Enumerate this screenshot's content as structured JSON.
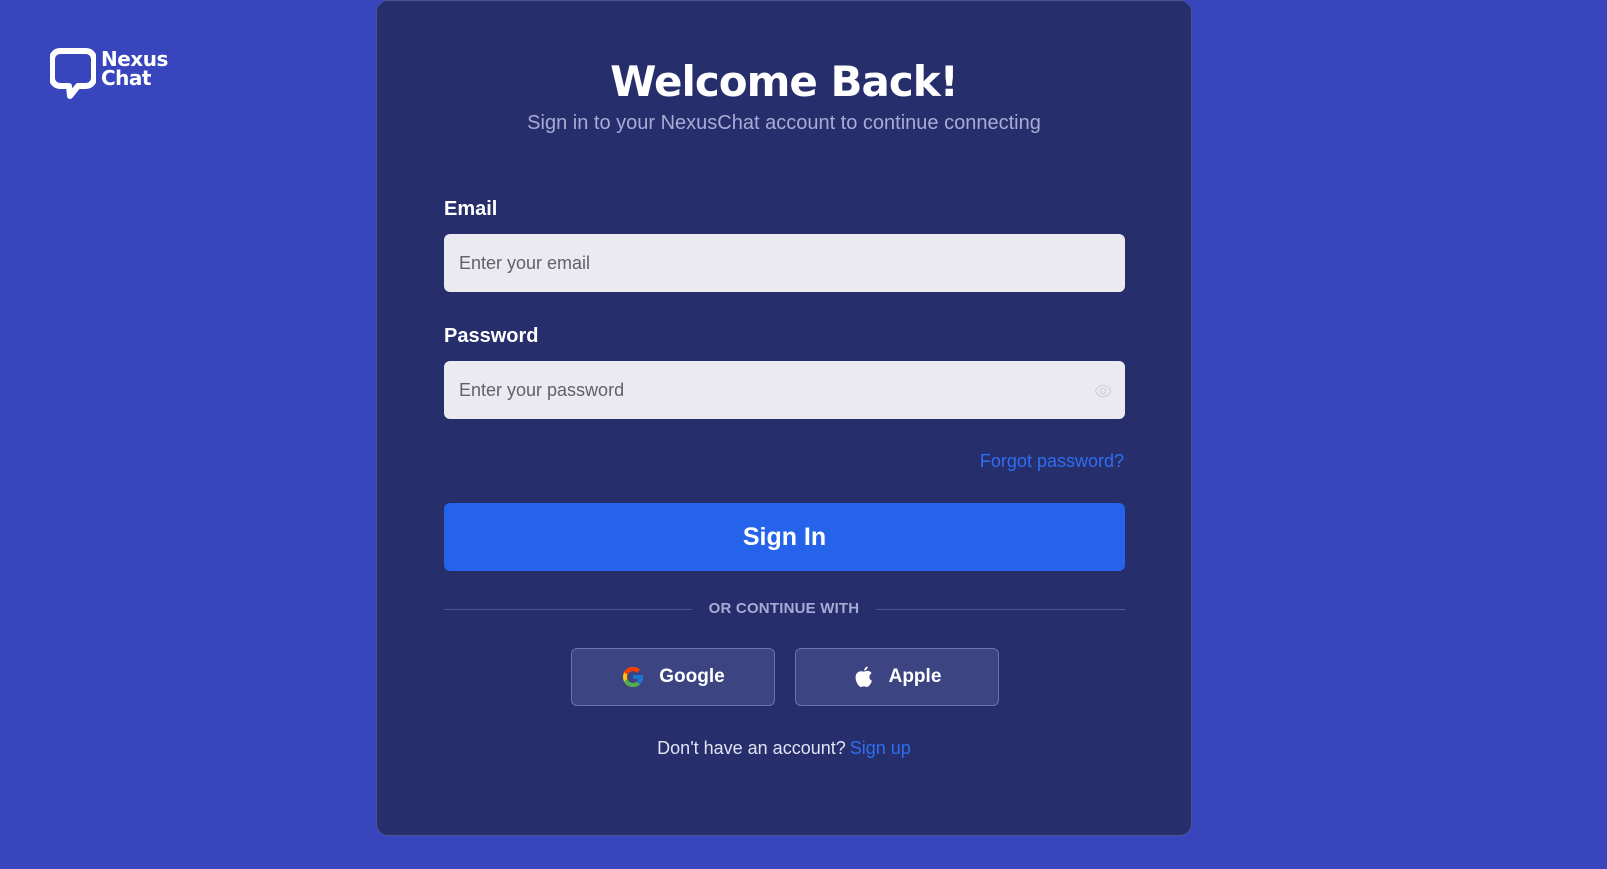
{
  "brand": {
    "name_line1": "Nexus",
    "name_line2": "Chat",
    "logo_icon": "speech-bubble-icon"
  },
  "header": {
    "title": "Welcome Back!",
    "subtitle": "Sign in to your NexusChat account to continue connecting"
  },
  "form": {
    "email_label": "Email",
    "email_placeholder": "Enter your email",
    "email_value": "",
    "password_label": "Password",
    "password_placeholder": "Enter your password",
    "password_value": "",
    "password_toggle_icon": "eye-icon",
    "forgot_label": "Forgot password?",
    "submit_label": "Sign In"
  },
  "divider": {
    "text": "OR CONTINUE WITH"
  },
  "social": {
    "google_label": "Google",
    "google_icon": "google-icon",
    "apple_label": "Apple",
    "apple_icon": "apple-icon"
  },
  "footer": {
    "prompt": "Don't have an account?",
    "signup_label": "Sign up"
  },
  "colors": {
    "background": "#3845bd",
    "card": "#262e6c",
    "primary": "#2563eb",
    "link": "#2f6ef0",
    "input_bg": "#ebeaf0"
  }
}
